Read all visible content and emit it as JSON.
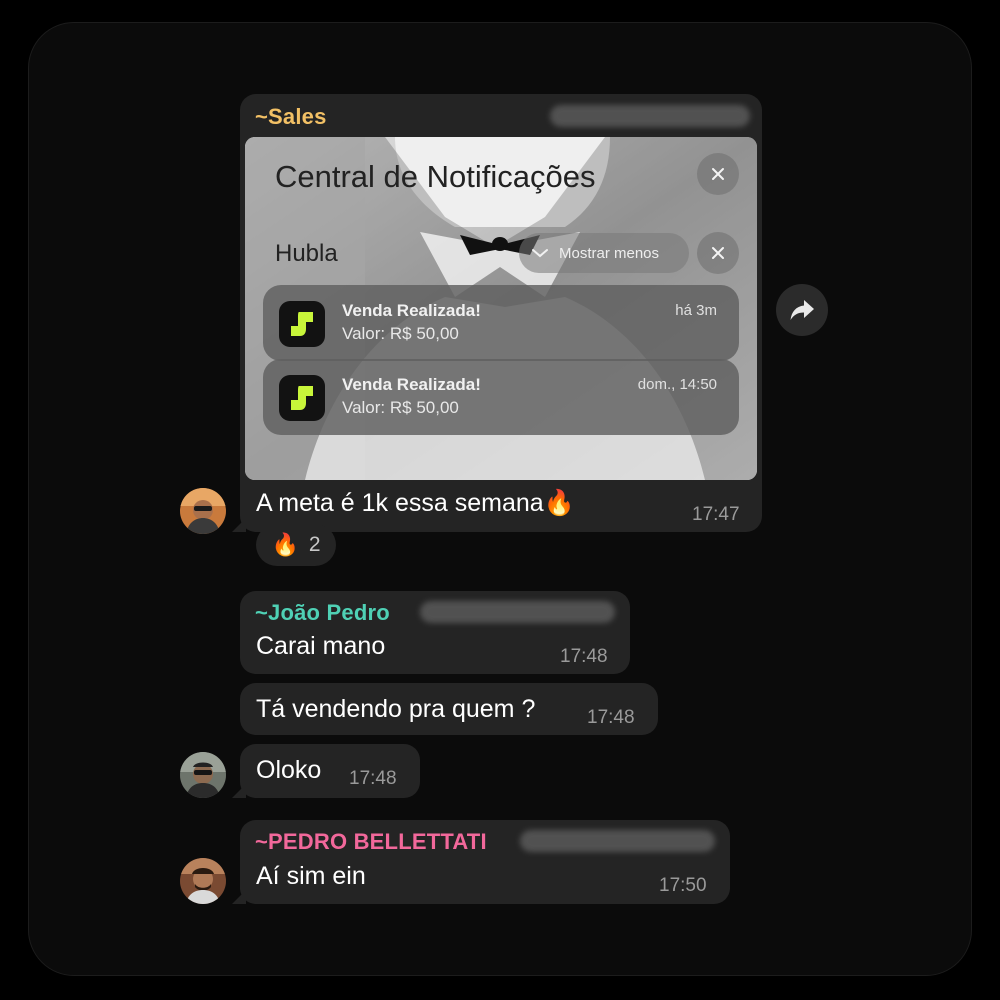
{
  "messages": {
    "first": {
      "sender": "~Sales",
      "sender_color": "#f2c065",
      "text": "A meta é 1k essa semana",
      "emoji": "🔥",
      "time": "17:47",
      "reaction": {
        "emoji": "🔥",
        "count": "2"
      }
    },
    "joao": {
      "sender": "~João Pedro",
      "sender_color": "#4fd1b5",
      "text": "Carai mano",
      "time": "17:48"
    },
    "vendendo": {
      "text": "Tá vendendo pra quem ?",
      "time": "17:48"
    },
    "oloko": {
      "text": "Oloko",
      "time": "17:48"
    },
    "pedro": {
      "sender": "~PEDRO BELLETTATI",
      "sender_color": "#f2689b",
      "text": "Aí sim ein",
      "time": "17:50"
    }
  },
  "screenshot": {
    "title": "Central de Notificações",
    "app_name": "Hubla",
    "collapse_label": "Mostrar menos",
    "notifications": [
      {
        "title": "Venda Realizada!",
        "body": "Valor: R$ 50,00",
        "time": "há 3m"
      },
      {
        "title": "Venda Realizada!",
        "body": "Valor: R$ 50,00",
        "time": "dom., 14:50"
      }
    ],
    "accent": "#c8f53a"
  },
  "icons": {
    "share": "forward-arrow-icon",
    "close": "close-icon",
    "chevron": "chevron-down-icon"
  }
}
